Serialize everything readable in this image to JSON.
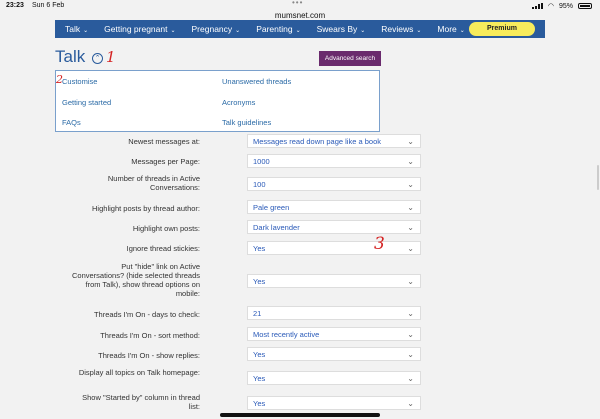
{
  "status": {
    "time": "23:23",
    "date": "Sun 6 Feb",
    "battery": "95%"
  },
  "url": "mumsnet.com",
  "nav": {
    "items": [
      "Talk",
      "Getting pregnant",
      "Pregnancy",
      "Parenting",
      "Swears By",
      "Reviews",
      "More"
    ],
    "premium": "Premium"
  },
  "page": {
    "title": "Talk",
    "advanced_search": "Advanced search"
  },
  "menu": {
    "left": [
      "Customise",
      "Getting started",
      "FAQs"
    ],
    "right": [
      "Unanswered threads",
      "Acronyms",
      "Talk guidelines"
    ]
  },
  "settings": [
    {
      "label": "Newest messages at:",
      "value": "Messages read down page like a book"
    },
    {
      "label": "Messages per Page:",
      "value": "1000"
    },
    {
      "label": "Number of threads in Active Conversations:",
      "value": "100"
    },
    {
      "label": "Highlight posts by thread author:",
      "value": "Pale green"
    },
    {
      "label": "Highlight own posts:",
      "value": "Dark lavender"
    },
    {
      "label": "Ignore thread stickies:",
      "value": "Yes"
    },
    {
      "label": "Put \"hide\" link on Active Conversations? (hide selected threads from Talk), show thread options on mobile:",
      "value": "Yes"
    },
    {
      "label": "Threads I'm On - days to check:",
      "value": "21"
    },
    {
      "label": "Threads I'm On - sort method:",
      "value": "Most recently active"
    },
    {
      "label": "Threads I'm On - show replies:",
      "value": "Yes"
    },
    {
      "label": "Display all topics on Talk homepage:",
      "value": "Yes"
    },
    {
      "label": "Show \"Started by\" column in thread list:",
      "value": "Yes"
    }
  ],
  "annotations": [
    "1",
    "2",
    "3"
  ],
  "colors": {
    "nav": "#2a5b9c",
    "premium": "#f7ec5c",
    "advanced": "#6a2a6d",
    "link": "#2a6aa6",
    "annotation": "#d42222"
  }
}
